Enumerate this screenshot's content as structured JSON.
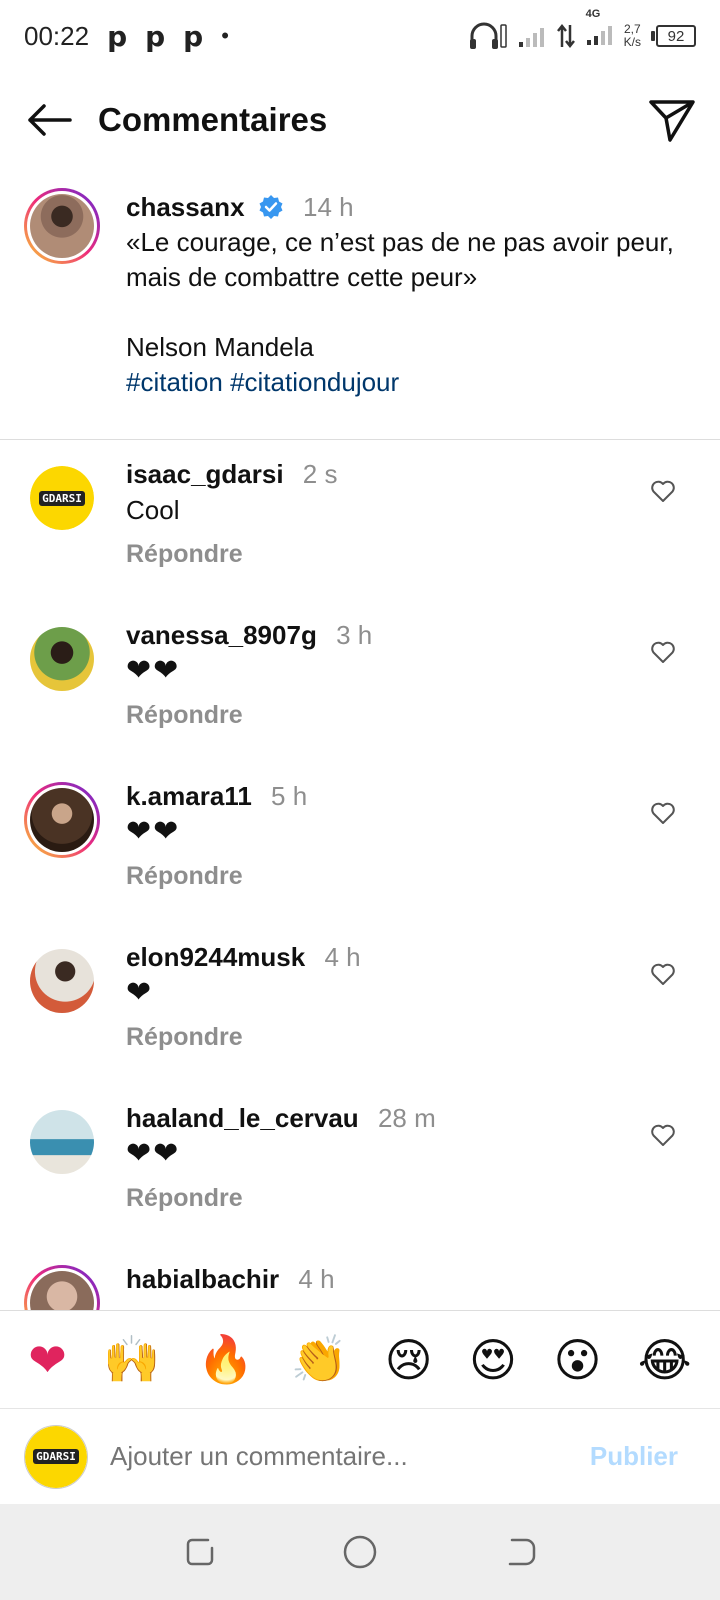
{
  "status_bar": {
    "time": "00:22",
    "notif_icons": [
      "p",
      "p",
      "p",
      "•"
    ],
    "network_label": "4G",
    "speed_value": "2,7",
    "speed_unit": "K/s",
    "battery": "92"
  },
  "header": {
    "title": "Commentaires"
  },
  "caption": {
    "username": "chassanx",
    "time": "14 h",
    "text_line1": "«Le courage, ce n’est pas de ne pas avoir peur, mais de combattre cette peur»",
    "text_line2": "Nelson Mandela",
    "hashtags": "#citation #citationdujour"
  },
  "comments": [
    {
      "username": "isaac_gdarsi",
      "time": "2 s",
      "text": "Cool",
      "reply": "Répondre"
    },
    {
      "username": "vanessa_8907g",
      "time": "3 h",
      "text": "❤❤",
      "reply": "Répondre"
    },
    {
      "username": "k.amara11",
      "time": "5 h",
      "text": "❤❤",
      "reply": "Répondre"
    },
    {
      "username": "elon9244musk",
      "time": "4 h",
      "text": "❤",
      "reply": "Répondre"
    },
    {
      "username": "haaland_le_cervau",
      "time": "28 m",
      "text": "❤❤",
      "reply": "Répondre"
    },
    {
      "username": "habialbachir",
      "time": "4 h",
      "text": "",
      "reply": ""
    }
  ],
  "gdarsi_label": "GDARSI",
  "emoji_bar": [
    "❤",
    "🙌",
    "🔥",
    "👏",
    "😢",
    "😍",
    "😮",
    "😂"
  ],
  "add_comment": {
    "placeholder": "Ajouter un commentaire...",
    "publish": "Publier"
  },
  "colors": {
    "hashtag": "#00376b",
    "muted": "#8e8e8e",
    "publish": "#b3dbff",
    "verified": "#3897f0",
    "story_ring": "#ee2a7b"
  }
}
